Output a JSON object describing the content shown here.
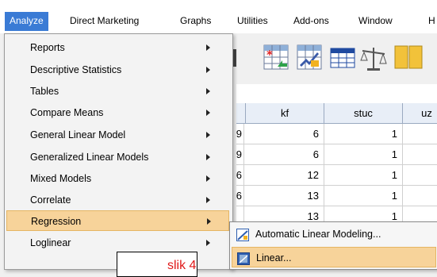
{
  "menubar": {
    "items": [
      "Analyze",
      "Direct Marketing",
      "Graphs",
      "Utilities",
      "Add-ons",
      "Window",
      "H"
    ],
    "active": "Analyze"
  },
  "grid": {
    "columns": [
      "kf",
      "stuc",
      "uz"
    ],
    "rows": [
      {
        "stub": "9",
        "kf": "6",
        "stuc": "1"
      },
      {
        "stub": "9",
        "kf": "6",
        "stuc": "1"
      },
      {
        "stub": "6",
        "kf": "12",
        "stuc": "1"
      },
      {
        "stub": "6",
        "kf": "13",
        "stuc": "1"
      },
      {
        "stub": "",
        "kf": "13",
        "stuc": "1"
      }
    ]
  },
  "analyze_menu": {
    "items": [
      {
        "label": "Reports",
        "submenu": true
      },
      {
        "label": "Descriptive Statistics",
        "submenu": true
      },
      {
        "label": "Tables",
        "submenu": true
      },
      {
        "label": "Compare Means",
        "submenu": true
      },
      {
        "label": "General Linear Model",
        "submenu": true
      },
      {
        "label": "Generalized Linear Models",
        "submenu": true
      },
      {
        "label": "Mixed Models",
        "submenu": true
      },
      {
        "label": "Correlate",
        "submenu": true
      },
      {
        "label": "Regression",
        "submenu": true,
        "selected": true
      },
      {
        "label": "Loglinear",
        "submenu": true
      }
    ]
  },
  "regression_submenu": {
    "items": [
      {
        "label": "Automatic Linear Modeling...",
        "icon": "automatic-linear-modeling-icon"
      },
      {
        "label": "Linear...",
        "icon": "linear-regression-icon",
        "highlighted": true
      }
    ]
  },
  "annotation": {
    "text": "slik 4"
  },
  "colors": {
    "menubar_active": "#3a7bd5",
    "menu_selected": "#f7d39a",
    "annotation_text": "#e01818"
  }
}
